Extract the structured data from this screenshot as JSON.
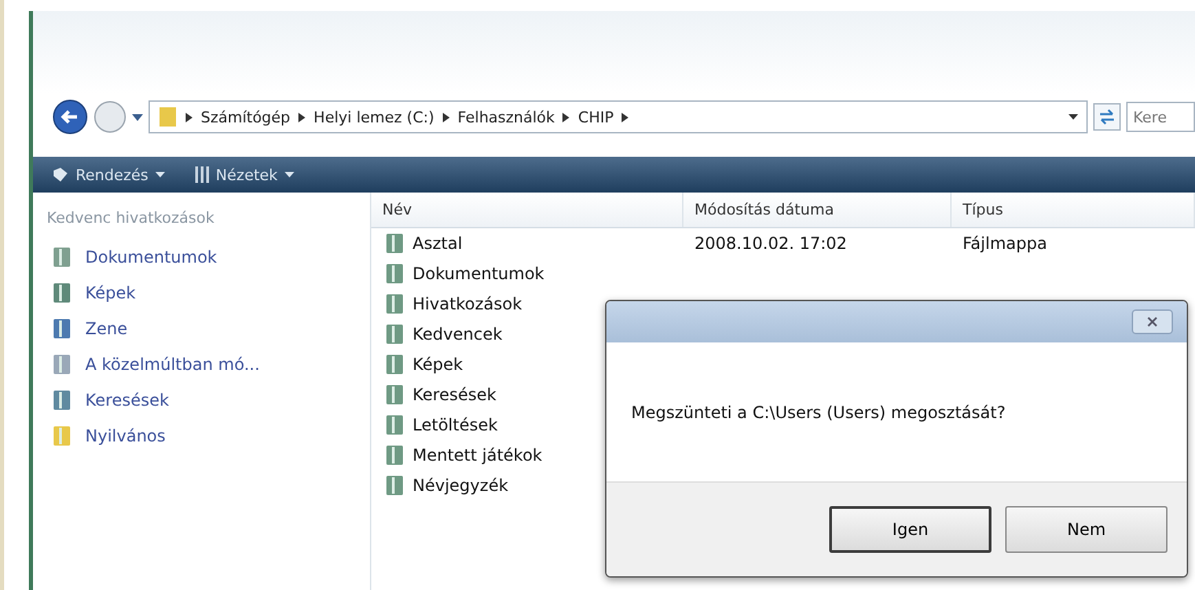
{
  "address_bar": {
    "crumbs": [
      "Számítógép",
      "Helyi lemez (C:)",
      "Felhasználók",
      "CHIP"
    ],
    "search": {
      "placeholder": "Kere"
    }
  },
  "toolbar": {
    "buttons": [
      "Rendezés",
      "Nézetek"
    ]
  },
  "sidebar": {
    "heading": "Kedvenc hivatkozások",
    "items": [
      {
        "label": "Dokumentumok",
        "kind": "docs"
      },
      {
        "label": "Képek",
        "kind": "pics"
      },
      {
        "label": "Zene",
        "kind": "music"
      },
      {
        "label": "A közelmúltban mó...",
        "kind": "recent"
      },
      {
        "label": "Keresések",
        "kind": "search"
      },
      {
        "label": "Nyilvános",
        "kind": "folder"
      }
    ]
  },
  "table": {
    "columns": [
      "Név",
      "Módosítás dátuma",
      "Típus"
    ],
    "rows": [
      {
        "name": "Asztal",
        "date": "2008.10.02. 17:02",
        "type": "Fájlmappa"
      },
      {
        "name": "Dokumentumok"
      },
      {
        "name": "Hivatkozások"
      },
      {
        "name": "Kedvencek"
      },
      {
        "name": "Képek"
      },
      {
        "name": "Keresések"
      },
      {
        "name": "Letöltések"
      },
      {
        "name": "Mentett játékok"
      },
      {
        "name": "Névjegyzék"
      }
    ]
  },
  "dialog": {
    "message": "Megszünteti a C:\\Users (Users) megosztását?",
    "buttons": [
      {
        "label": "Igen",
        "selected": true
      },
      {
        "label": "Nem",
        "selected": false
      }
    ]
  }
}
